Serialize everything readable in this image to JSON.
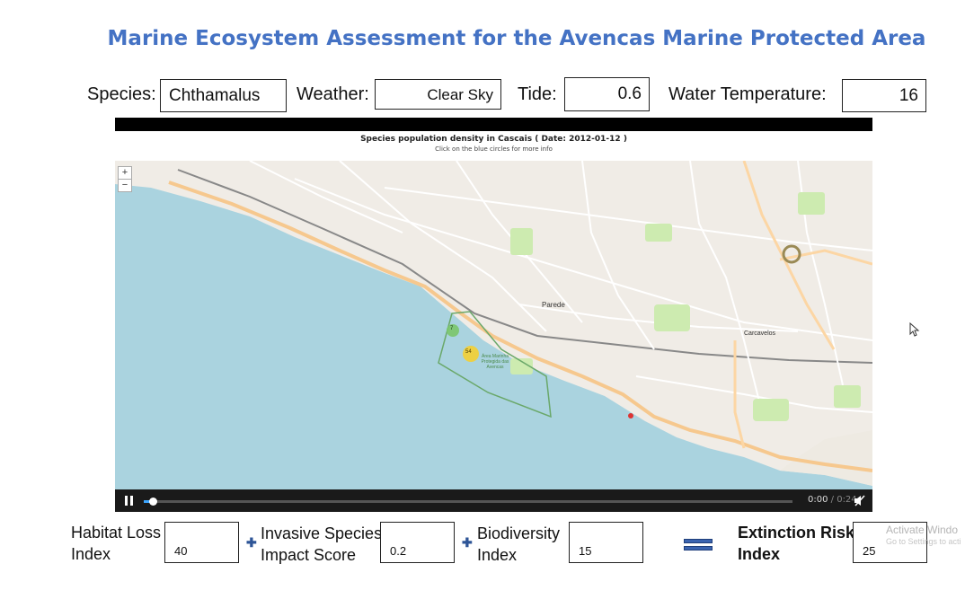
{
  "title": "Marine Ecosystem Assessment for the Avencas Marine Protected Area",
  "top_controls": {
    "species_label": "Species:",
    "species_value": "Chthamalus",
    "weather_label": "Weather:",
    "weather_value": "Clear Sky",
    "tide_label": "Tide:",
    "tide_value": "0.6",
    "water_temp_label": "Water Temperature:",
    "water_temp_value": "16"
  },
  "video": {
    "chart_title": "Species population density in Cascais ( Date: 2012-01-12 )",
    "chart_subtitle": "Click on the blue circles for more info",
    "zoom_in": "+",
    "zoom_out": "−",
    "map_labels": {
      "parede": "Parede",
      "carcavelos": "Carcavelos",
      "reserve": "Área Marinha Protegida das Avencas",
      "cluster_small": "7",
      "cluster_large": "54"
    },
    "time_current": "0:00",
    "time_total": "/ 0:24",
    "progress": 0.017
  },
  "bottom": {
    "habitat_loss_label_1": "Habitat Loss",
    "habitat_loss_label_2": "Index",
    "habitat_loss_value": "40",
    "invasive_label_1": "Invasive Species",
    "invasive_label_2": "Impact Score",
    "invasive_value": "0.2",
    "biodiversity_label_1": "Biodiversity",
    "biodiversity_label_2": "Index",
    "biodiversity_value": "15",
    "extinction_label_1": "Extinction Risk",
    "extinction_label_2": "Index",
    "extinction_value": "25",
    "plus_symbol": "✚"
  },
  "watermark": {
    "line1": "Activate Windo",
    "line2": "Go to Settings to acti"
  },
  "colors": {
    "title": "#4472c4",
    "sea": "#aad3df",
    "land": "#f2efe9",
    "road_major": "#fcd6a4",
    "park": "#c8facc",
    "cluster_small": "#7ac56a",
    "cluster_large": "#f0d03a",
    "accent": "#3ea6ff"
  }
}
